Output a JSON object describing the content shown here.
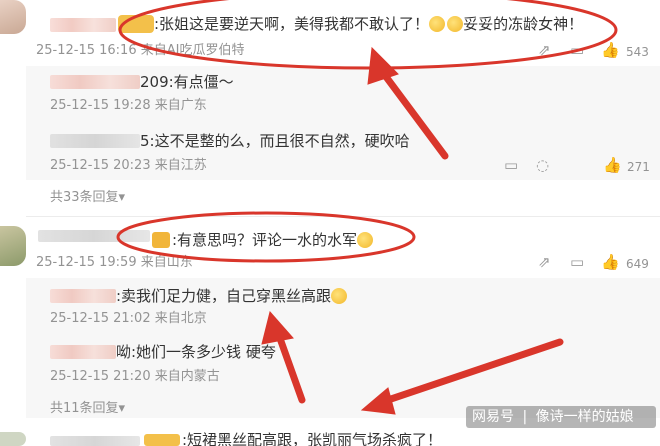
{
  "comments": [
    {
      "text": ":张姐这是要逆天啊，美得我都不敢认了！",
      "tail": "妥妥的冻龄女神！",
      "time": "25-12-15 16:16",
      "source": "来自AI吃瓜罗伯特",
      "like_count": "543",
      "replies": [
        {
          "text": "209:有点僵～",
          "time": "25-12-15 19:28",
          "source": "来自广东"
        },
        {
          "text": "5:这不是整的么，而且很不自然，硬吹哈",
          "time": "25-12-15 20:23",
          "source": "来自江苏",
          "like_count": "271"
        }
      ],
      "more_replies": "共33条回复▾"
    },
    {
      "text": ":有意思吗？评论一水的水军",
      "time": "25-12-15 19:59",
      "source": "来自山东",
      "like_count": "649",
      "replies": [
        {
          "text": ":卖我们足力健，自己穿黑丝高跟",
          "time": "25-12-15 21:02",
          "source": "来自北京"
        },
        {
          "text": "呦:她们一条多少钱 硬夸",
          "time": "25-12-15 21:20",
          "source": "来自内蒙古"
        }
      ],
      "more_replies": "共11条回复▾"
    }
  ],
  "bottom_partial_text": ":短裙黑丝配高跟，张凯丽气场杀疯了！",
  "watermark": {
    "brand": "网易号",
    "author": "像诗一样的姑娘"
  },
  "colors": {
    "annotation": "#d9362b",
    "meta": "#939393"
  }
}
